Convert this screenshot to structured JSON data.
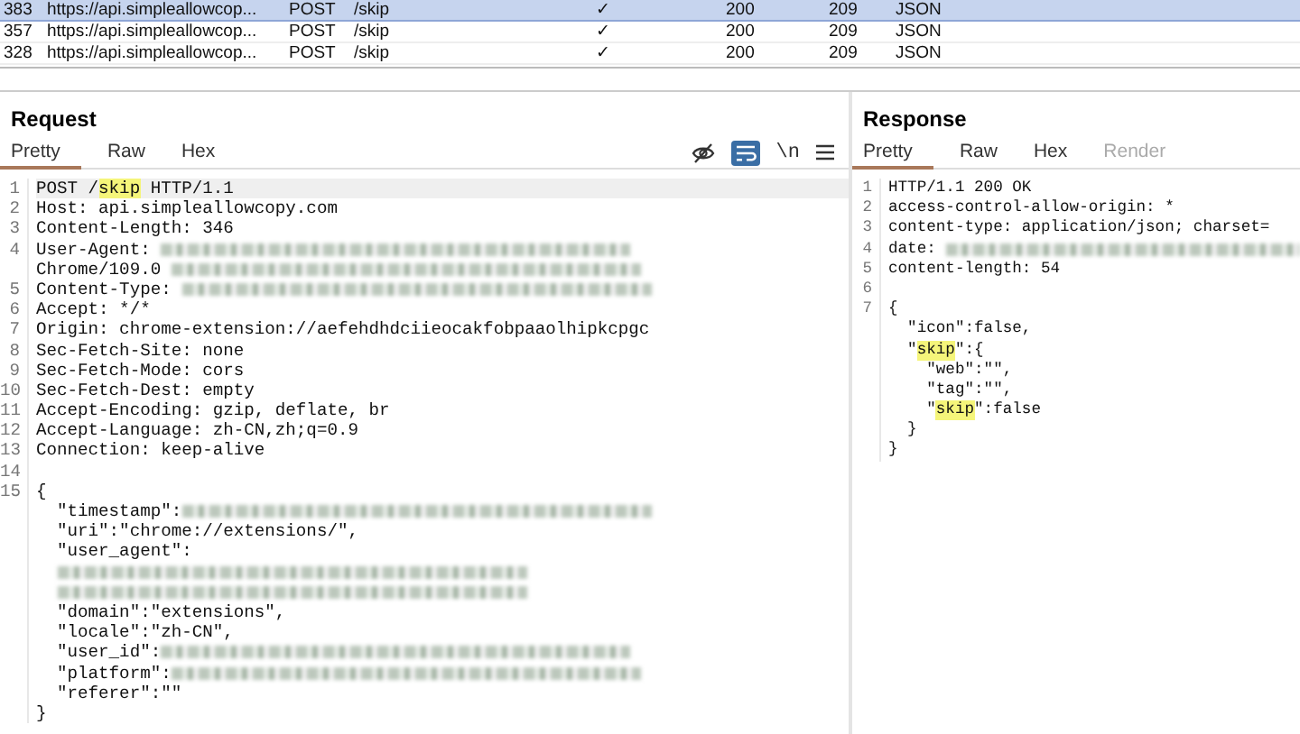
{
  "history_table": {
    "rows": [
      {
        "selected": true,
        "cells": [
          "383",
          "https://api.simpleallowcop...",
          "POST",
          "/skip",
          "✓",
          "200",
          "209",
          "JSON"
        ]
      },
      {
        "selected": false,
        "cells": [
          "357",
          "https://api.simpleallowcop...",
          "POST",
          "/skip",
          "✓",
          "200",
          "209",
          "JSON"
        ]
      },
      {
        "selected": false,
        "cells": [
          "328",
          "https://api.simpleallowcop...",
          "POST",
          "/skip",
          "✓",
          "200",
          "209",
          "JSON"
        ]
      }
    ]
  },
  "request": {
    "title": "Request",
    "tabs": [
      {
        "label": "Pretty",
        "selected": true,
        "disabled": false
      },
      {
        "label": "Raw",
        "selected": false,
        "disabled": false
      },
      {
        "label": "Hex",
        "selected": false,
        "disabled": false
      }
    ],
    "toolbar": [
      {
        "kind": "hide",
        "on": false
      },
      {
        "kind": "wrap",
        "on": true
      },
      {
        "kind": "newline",
        "label": "\\n",
        "on": false
      },
      {
        "kind": "menu",
        "on": false
      }
    ],
    "lines": [
      {
        "number": "1",
        "current": true,
        "segments": [
          {
            "kind": "text",
            "text": "POST /"
          },
          {
            "kind": "highlight",
            "text": "skip"
          },
          {
            "kind": "text",
            "text": " HTTP/1.1"
          }
        ]
      },
      {
        "number": "2",
        "current": false,
        "segments": [
          {
            "kind": "text",
            "text": "Host: api.simpleallowcopy.com"
          }
        ]
      },
      {
        "number": "3",
        "current": false,
        "segments": [
          {
            "kind": "text",
            "text": "Content-Length: 346"
          }
        ]
      },
      {
        "number": "4",
        "current": false,
        "segments": [
          {
            "kind": "text",
            "text": "User-Agent: "
          },
          {
            "kind": "redacted"
          }
        ]
      },
      {
        "current": false,
        "segments": [
          {
            "kind": "text",
            "text": "Chrome/109.0 "
          },
          {
            "kind": "redacted"
          }
        ]
      },
      {
        "number": "5",
        "current": false,
        "segments": [
          {
            "kind": "text",
            "text": "Content-Type: "
          },
          {
            "kind": "redacted"
          }
        ]
      },
      {
        "number": "6",
        "current": false,
        "segments": [
          {
            "kind": "text",
            "text": "Accept: */*"
          }
        ]
      },
      {
        "number": "7",
        "current": false,
        "segments": [
          {
            "kind": "text",
            "text": "Origin: chrome-extension://aefehdhdciieocakfobpaaolhipkcpgc"
          }
        ]
      },
      {
        "number": "8",
        "current": false,
        "segments": [
          {
            "kind": "text",
            "text": "Sec-Fetch-Site: none"
          }
        ]
      },
      {
        "number": "9",
        "current": false,
        "segments": [
          {
            "kind": "text",
            "text": "Sec-Fetch-Mode: cors"
          }
        ]
      },
      {
        "number": "10",
        "current": false,
        "segments": [
          {
            "kind": "text",
            "text": "Sec-Fetch-Dest: empty"
          }
        ]
      },
      {
        "number": "11",
        "current": false,
        "segments": [
          {
            "kind": "text",
            "text": "Accept-Encoding: gzip, deflate, br"
          }
        ]
      },
      {
        "number": "12",
        "current": false,
        "segments": [
          {
            "kind": "text",
            "text": "Accept-Language: zh-CN,zh;q=0.9"
          }
        ]
      },
      {
        "number": "13",
        "current": false,
        "segments": [
          {
            "kind": "text",
            "text": "Connection: keep-alive"
          }
        ]
      },
      {
        "number": "14",
        "current": false
      },
      {
        "number": "15",
        "current": false,
        "segments": [
          {
            "kind": "text",
            "text": "{"
          }
        ]
      },
      {
        "current": false,
        "segments": [
          {
            "kind": "text",
            "text": "  \"timestamp\":"
          },
          {
            "kind": "redacted"
          }
        ]
      },
      {
        "current": false,
        "segments": [
          {
            "kind": "text",
            "text": "  \"uri\":\"chrome://extensions/\","
          }
        ]
      },
      {
        "current": false,
        "segments": [
          {
            "kind": "text",
            "text": "  \"user_agent\":"
          }
        ]
      },
      {
        "current": false,
        "segments": [
          {
            "kind": "indent"
          },
          {
            "kind": "redacted"
          }
        ]
      },
      {
        "current": false,
        "segments": [
          {
            "kind": "indent"
          },
          {
            "kind": "redacted"
          }
        ]
      },
      {
        "current": false,
        "segments": [
          {
            "kind": "text",
            "text": "  \"domain\":\"extensions\","
          }
        ]
      },
      {
        "current": false,
        "segments": [
          {
            "kind": "text",
            "text": "  \"locale\":\"zh-CN\","
          }
        ]
      },
      {
        "current": false,
        "segments": [
          {
            "kind": "text",
            "text": "  \"user_id\":"
          },
          {
            "kind": "redacted"
          }
        ]
      },
      {
        "current": false,
        "segments": [
          {
            "kind": "text",
            "text": "  \"platform\":"
          },
          {
            "kind": "redacted"
          }
        ]
      },
      {
        "current": false,
        "segments": [
          {
            "kind": "text",
            "text": "  \"referer\":\"\""
          }
        ]
      },
      {
        "current": false,
        "segments": [
          {
            "kind": "text",
            "text": "}"
          }
        ]
      }
    ]
  },
  "response": {
    "title": "Response",
    "tabs": [
      {
        "label": "Pretty",
        "selected": true,
        "disabled": false
      },
      {
        "label": "Raw",
        "selected": false,
        "disabled": false
      },
      {
        "label": "Hex",
        "selected": false,
        "disabled": false
      },
      {
        "label": "Render",
        "selected": false,
        "disabled": true
      }
    ],
    "lines": [
      {
        "number": "1",
        "current": false,
        "segments": [
          {
            "kind": "text",
            "text": "HTTP/1.1 200 OK"
          }
        ]
      },
      {
        "number": "2",
        "current": false,
        "segments": [
          {
            "kind": "text",
            "text": "access-control-allow-origin: *"
          }
        ]
      },
      {
        "number": "3",
        "current": false,
        "segments": [
          {
            "kind": "text",
            "text": "content-type: application/json; charset="
          }
        ]
      },
      {
        "number": "4",
        "current": false,
        "segments": [
          {
            "kind": "text",
            "text": "date: "
          },
          {
            "kind": "redacted"
          }
        ]
      },
      {
        "number": "5",
        "current": false,
        "segments": [
          {
            "kind": "text",
            "text": "content-length: 54"
          }
        ]
      },
      {
        "number": "6",
        "current": false
      },
      {
        "number": "7",
        "current": false,
        "segments": [
          {
            "kind": "text",
            "text": "{"
          }
        ]
      },
      {
        "current": false,
        "segments": [
          {
            "kind": "text",
            "text": "  \"icon\":false,"
          }
        ]
      },
      {
        "current": false,
        "segments": [
          {
            "kind": "text",
            "text": "  \""
          },
          {
            "kind": "highlight",
            "text": "skip"
          },
          {
            "kind": "text",
            "text": "\":{"
          }
        ]
      },
      {
        "current": false,
        "segments": [
          {
            "kind": "text",
            "text": "    \"web\":\"\","
          }
        ]
      },
      {
        "current": false,
        "segments": [
          {
            "kind": "text",
            "text": "    \"tag\":\"\","
          }
        ]
      },
      {
        "current": false,
        "segments": [
          {
            "kind": "text",
            "text": "    \""
          },
          {
            "kind": "highlight",
            "text": "skip"
          },
          {
            "kind": "text",
            "text": "\":false"
          }
        ]
      },
      {
        "current": false,
        "segments": [
          {
            "kind": "text",
            "text": "  }"
          }
        ]
      },
      {
        "current": false,
        "segments": [
          {
            "kind": "text",
            "text": "}"
          }
        ]
      }
    ]
  }
}
